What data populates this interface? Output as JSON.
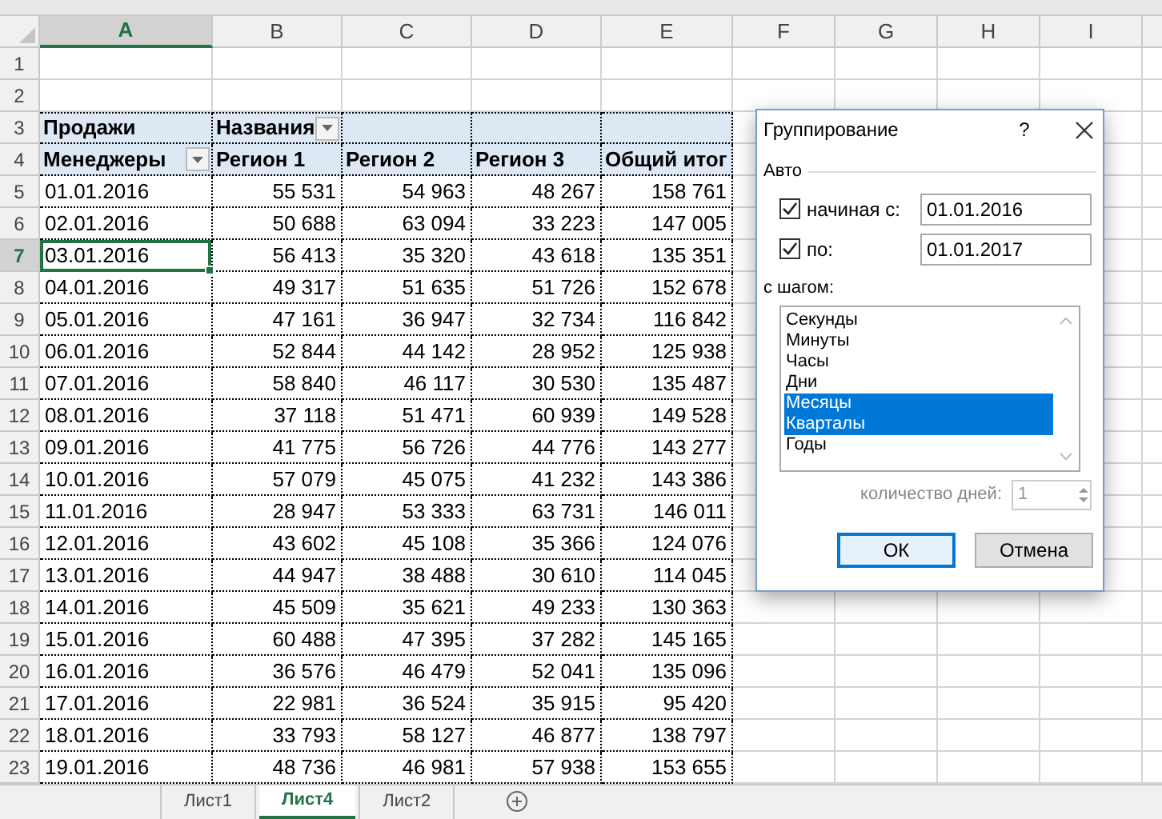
{
  "columns": [
    {
      "label": "A",
      "selected": true
    },
    {
      "label": "B",
      "selected": false
    },
    {
      "label": "C",
      "selected": false
    },
    {
      "label": "D",
      "selected": false
    },
    {
      "label": "E",
      "selected": false
    },
    {
      "label": "F",
      "selected": false
    },
    {
      "label": "G",
      "selected": false
    },
    {
      "label": "H",
      "selected": false
    },
    {
      "label": "I",
      "selected": false
    }
  ],
  "row_numbers": [
    {
      "label": "1",
      "selected": false
    },
    {
      "label": "2",
      "selected": false
    },
    {
      "label": "3",
      "selected": false
    },
    {
      "label": "4",
      "selected": false
    },
    {
      "label": "5",
      "selected": false
    },
    {
      "label": "6",
      "selected": false
    },
    {
      "label": "7",
      "selected": true
    },
    {
      "label": "8",
      "selected": false
    },
    {
      "label": "9",
      "selected": false
    },
    {
      "label": "10",
      "selected": false
    },
    {
      "label": "11",
      "selected": false
    },
    {
      "label": "12",
      "selected": false
    },
    {
      "label": "13",
      "selected": false
    },
    {
      "label": "14",
      "selected": false
    },
    {
      "label": "15",
      "selected": false
    },
    {
      "label": "16",
      "selected": false
    },
    {
      "label": "17",
      "selected": false
    },
    {
      "label": "18",
      "selected": false
    },
    {
      "label": "19",
      "selected": false
    },
    {
      "label": "20",
      "selected": false
    },
    {
      "label": "21",
      "selected": false
    },
    {
      "label": "22",
      "selected": false
    },
    {
      "label": "23",
      "selected": false
    }
  ],
  "pivot": {
    "values_label": "Продажи",
    "columns_label": "Названия",
    "rows_label": "Менеджеры",
    "headers": [
      "Регион 1",
      "Регион 2",
      "Регион 3",
      "Общий итог"
    ],
    "rows": [
      {
        "label": "01.01.2016",
        "selected": false,
        "values": [
          "55 531",
          "54 963",
          "48 267",
          "158 761"
        ]
      },
      {
        "label": "02.01.2016",
        "selected": false,
        "values": [
          "50 688",
          "63 094",
          "33 223",
          "147 005"
        ]
      },
      {
        "label": "03.01.2016",
        "selected": true,
        "values": [
          "56 413",
          "35 320",
          "43 618",
          "135 351"
        ]
      },
      {
        "label": "04.01.2016",
        "selected": false,
        "values": [
          "49 317",
          "51 635",
          "51 726",
          "152 678"
        ]
      },
      {
        "label": "05.01.2016",
        "selected": false,
        "values": [
          "47 161",
          "36 947",
          "32 734",
          "116 842"
        ]
      },
      {
        "label": "06.01.2016",
        "selected": false,
        "values": [
          "52 844",
          "44 142",
          "28 952",
          "125 938"
        ]
      },
      {
        "label": "07.01.2016",
        "selected": false,
        "values": [
          "58 840",
          "46 117",
          "30 530",
          "135 487"
        ]
      },
      {
        "label": "08.01.2016",
        "selected": false,
        "values": [
          "37 118",
          "51 471",
          "60 939",
          "149 528"
        ]
      },
      {
        "label": "09.01.2016",
        "selected": false,
        "values": [
          "41 775",
          "56 726",
          "44 776",
          "143 277"
        ]
      },
      {
        "label": "10.01.2016",
        "selected": false,
        "values": [
          "57 079",
          "45 075",
          "41 232",
          "143 386"
        ]
      },
      {
        "label": "11.01.2016",
        "selected": false,
        "values": [
          "28 947",
          "53 333",
          "63 731",
          "146 011"
        ]
      },
      {
        "label": "12.01.2016",
        "selected": false,
        "values": [
          "43 602",
          "45 108",
          "35 366",
          "124 076"
        ]
      },
      {
        "label": "13.01.2016",
        "selected": false,
        "values": [
          "44 947",
          "38 488",
          "30 610",
          "114 045"
        ]
      },
      {
        "label": "14.01.2016",
        "selected": false,
        "values": [
          "45 509",
          "35 621",
          "49 233",
          "130 363"
        ]
      },
      {
        "label": "15.01.2016",
        "selected": false,
        "values": [
          "60 488",
          "47 395",
          "37 282",
          "145 165"
        ]
      },
      {
        "label": "16.01.2016",
        "selected": false,
        "values": [
          "36 576",
          "46 479",
          "52 041",
          "135 096"
        ]
      },
      {
        "label": "17.01.2016",
        "selected": false,
        "values": [
          "22 981",
          "36 524",
          "35 915",
          "95 420"
        ]
      },
      {
        "label": "18.01.2016",
        "selected": false,
        "values": [
          "33 793",
          "58 127",
          "46 877",
          "138 797"
        ]
      },
      {
        "label": "19.01.2016",
        "selected": false,
        "values": [
          "48 736",
          "46 981",
          "57 938",
          "153 655"
        ]
      }
    ]
  },
  "sheet_tabs": [
    {
      "label": "Лист1",
      "selected": false
    },
    {
      "label": "Лист4",
      "selected": true
    },
    {
      "label": "Лист2",
      "selected": false
    }
  ],
  "dialog": {
    "title": "Группирование",
    "help": "?",
    "section": "Авто",
    "start": {
      "label": "начиная с:",
      "checked": true,
      "value": "01.01.2016"
    },
    "end": {
      "label": "по:",
      "checked": true,
      "value": "01.01.2017"
    },
    "step_label": "с шагом:",
    "steps": [
      {
        "label": "Секунды",
        "selected": false
      },
      {
        "label": "Минуты",
        "selected": false
      },
      {
        "label": "Часы",
        "selected": false
      },
      {
        "label": "Дни",
        "selected": false
      },
      {
        "label": "Месяцы",
        "selected": true
      },
      {
        "label": "Кварталы",
        "selected": true
      },
      {
        "label": "Годы",
        "selected": false
      }
    ],
    "days": {
      "label": "количество дней:",
      "value": "1",
      "disabled": true
    },
    "ok": "ОК",
    "cancel": "Отмена"
  }
}
